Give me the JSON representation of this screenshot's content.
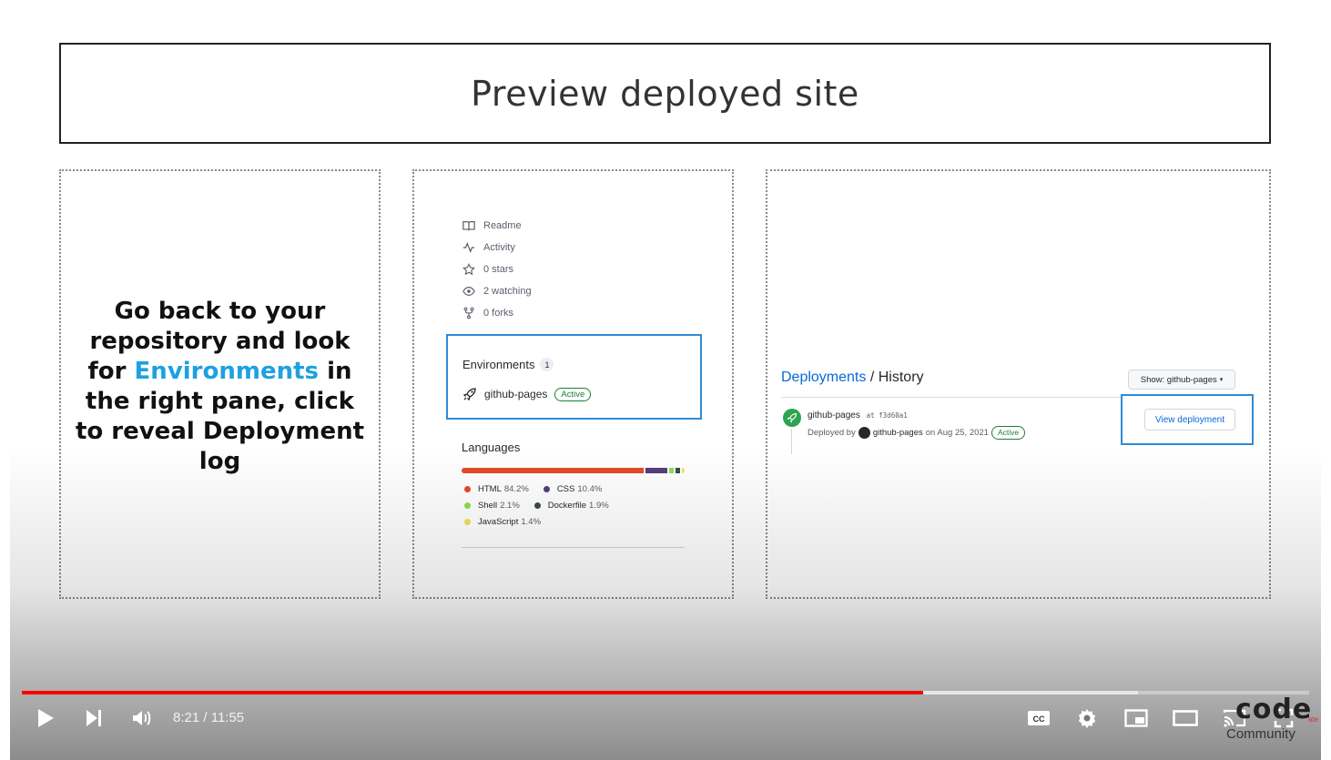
{
  "slide": {
    "title": "Preview deployed site",
    "instruction": {
      "before": "Go back to your repository and look for ",
      "highlight": "Environments",
      "after": " in the right pane, click to reveal Deployment log"
    }
  },
  "sidebar": {
    "items": [
      {
        "icon": "book-icon",
        "label": "Readme"
      },
      {
        "icon": "pulse-icon",
        "label": "Activity"
      },
      {
        "icon": "star-icon",
        "label": "0 stars"
      },
      {
        "icon": "eye-icon",
        "label": "2 watching"
      },
      {
        "icon": "fork-icon",
        "label": "0 forks"
      }
    ],
    "environments": {
      "title": "Environments",
      "count": "1",
      "item": {
        "name": "github-pages",
        "status": "Active"
      }
    },
    "languages": {
      "title": "Languages",
      "items": [
        {
          "name": "HTML",
          "percent": "84.2%",
          "share": 84.2,
          "color": "#e34c26"
        },
        {
          "name": "CSS",
          "percent": "10.4%",
          "share": 10.4,
          "color": "#563d7c"
        },
        {
          "name": "Shell",
          "percent": "2.1%",
          "share": 2.1,
          "color": "#89e051"
        },
        {
          "name": "Dockerfile",
          "percent": "1.9%",
          "share": 1.9,
          "color": "#384d54"
        },
        {
          "name": "JavaScript",
          "percent": "1.4%",
          "share": 1.4,
          "color": "#f1e05a"
        }
      ]
    }
  },
  "deployments": {
    "breadcrumb_link": "Deployments",
    "breadcrumb_sep": "/",
    "breadcrumb_current": "History",
    "filter_label": "Show: github-pages",
    "entry": {
      "environment": "github-pages",
      "at_label": "at",
      "sha": "f3d60a1",
      "deployed_by_label": "Deployed by",
      "actor": "github-pages",
      "date_text": "on Aug 25, 2021",
      "status": "Active"
    },
    "view_button": "View deployment"
  },
  "player": {
    "current_time": "8:21",
    "separator": "/",
    "duration": "11:55",
    "progress_fraction": 0.7,
    "buffered_fraction": 0.867,
    "accent_color": "#ff0000",
    "controls": [
      "play-icon",
      "next-icon",
      "volume-icon",
      "captions-icon",
      "settings-icon",
      "miniplayer-icon",
      "theater-icon",
      "cast-icon",
      "fullscreen-icon"
    ]
  },
  "watermark": {
    "brand": "code",
    "small": "ate",
    "community": "Community"
  }
}
